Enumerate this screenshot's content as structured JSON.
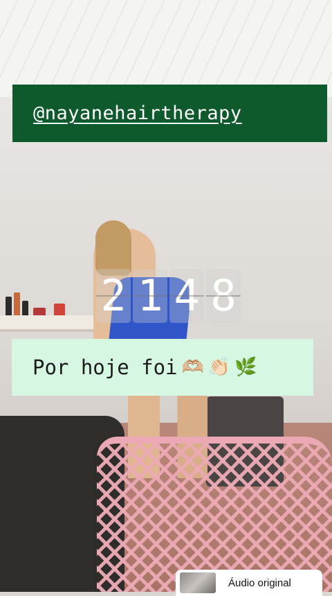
{
  "overlay": {
    "handle": "@nayanehairtherapy",
    "counter_digits": [
      "2",
      "1",
      "4",
      "8"
    ],
    "caption": "Por hoje foi",
    "caption_emojis": [
      "🫶🏼",
      "👏🏻",
      "🌿"
    ]
  },
  "audio": {
    "label": "Áudio original"
  },
  "colors": {
    "banner": "#0e5a2c",
    "caption_bg": "#d6f8e3"
  }
}
